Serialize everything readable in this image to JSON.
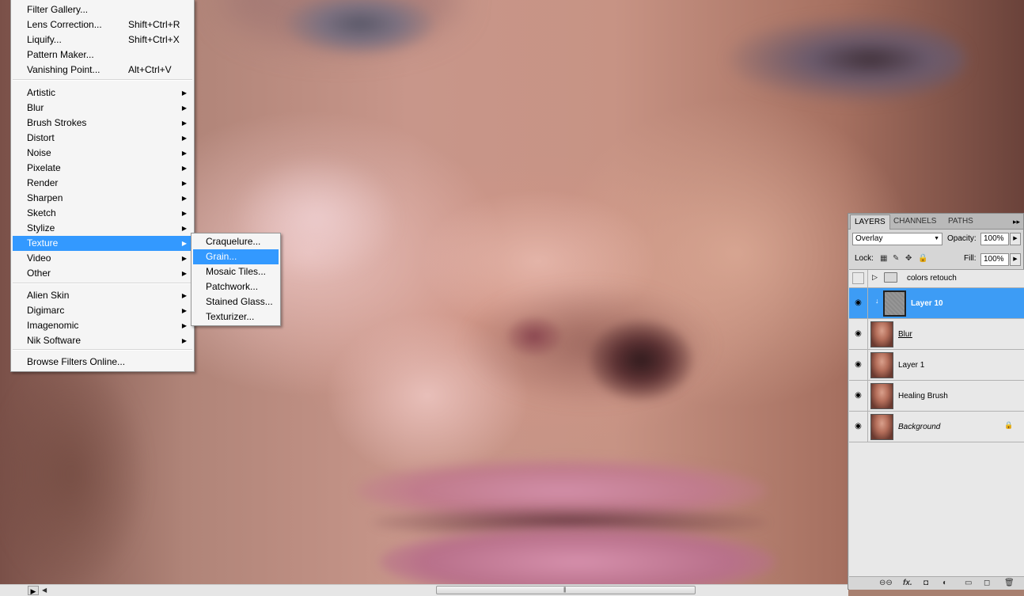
{
  "menu": {
    "items": [
      {
        "label": "Filter Gallery...",
        "shortcut": ""
      },
      {
        "label": "Lens Correction...",
        "shortcut": "Shift+Ctrl+R"
      },
      {
        "label": "Liquify...",
        "shortcut": "Shift+Ctrl+X"
      },
      {
        "label": "Pattern Maker...",
        "shortcut": ""
      },
      {
        "label": "Vanishing Point...",
        "shortcut": "Alt+Ctrl+V"
      }
    ],
    "groups": [
      "Artistic",
      "Blur",
      "Brush Strokes",
      "Distort",
      "Noise",
      "Pixelate",
      "Render",
      "Sharpen",
      "Sketch",
      "Stylize",
      "Texture",
      "Video",
      "Other"
    ],
    "plugins": [
      "Alien Skin",
      "Digimarc",
      "Imagenomic",
      "Nik Software"
    ],
    "browse": "Browse Filters Online...",
    "selected": "Texture"
  },
  "submenu": {
    "items": [
      "Craquelure...",
      "Grain...",
      "Mosaic Tiles...",
      "Patchwork...",
      "Stained Glass...",
      "Texturizer..."
    ],
    "highlighted": "Grain..."
  },
  "layers_panel": {
    "tabs": [
      "LAYERS",
      "CHANNELS",
      "PATHS"
    ],
    "active_tab": "LAYERS",
    "blend_mode": "Overlay",
    "opacity_label": "Opacity:",
    "opacity_value": "100%",
    "lock_label": "Lock:",
    "fill_label": "Fill:",
    "fill_value": "100%",
    "group_name": "colors retouch",
    "layers": [
      "Layer 10",
      "Blur",
      "Layer 1",
      "Healing Brush",
      "Background"
    ],
    "selected_layer": "Layer 10"
  },
  "colors": {
    "menu_highlight": "#3399ff",
    "layer_selected": "#3d9cf5"
  }
}
